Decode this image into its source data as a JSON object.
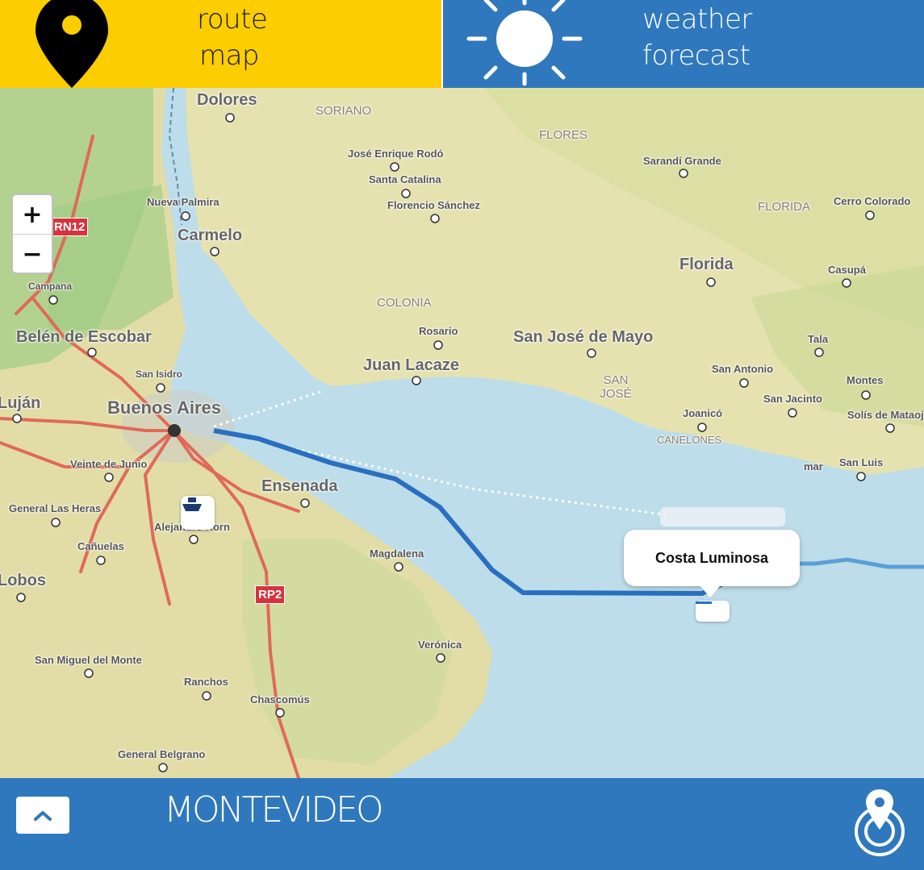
{
  "tabs": {
    "route": {
      "line1": "route",
      "line2": "map",
      "icon": "map-pin-icon",
      "color": "#fccd00"
    },
    "weather": {
      "line1": "weather",
      "line2": "forecast",
      "icon": "sun-icon",
      "color": "#2f78be"
    }
  },
  "map": {
    "zoom_in": "+",
    "zoom_out": "−",
    "labels": {
      "dolores": "Dolores",
      "soriano": "SORIANO",
      "flores": "FLORES",
      "jose_enrique_rodo": "José Enrique Rodó",
      "santa_catalina": "Santa Catalina",
      "florencio_sanchez": "Florencio Sánchez",
      "sarandi_grande": "Sarandí Grande",
      "florida_region": "FLORIDA",
      "cerro_colorado": "Cerro Colorado",
      "nueva_palmira": "Nueva Palmira",
      "carmelo": "Carmelo",
      "campana": "Campana",
      "florida": "Florida",
      "casupa": "Casupá",
      "colonia": "COLONIA",
      "belen_de_escobar": "Belén de Escobar",
      "rosario": "Rosario",
      "san_jose_de_mayo": "San José de Mayo",
      "tala": "Tala",
      "juan_lacaze": "Juan Lacaze",
      "san_isidro": "San Isidro",
      "san_antonio": "San Antonio",
      "montes": "Montes",
      "san_jose_region": "SAN JOSÉ",
      "lujan": "Luján",
      "buenos_aires": "Buenos Aires",
      "san_jacinto": "San Jacinto",
      "solis_de_mataojo": "Solís de Mataojo",
      "joanico": "Joanicó",
      "canelones": "CANELONES",
      "san_luis": "San Luis",
      "veinte_de_junio": "Veinte de Junio",
      "ensenada": "Ensenada",
      "general_las_heras": "General Las Heras",
      "alejandro_korn": "Alejandro Korn",
      "canuelas": "Cañuelas",
      "magdalena": "Magdalena",
      "lobos": "Lobos",
      "veronica": "Verónica",
      "san_miguel_del_monte": "San Miguel del Monte",
      "ranchos": "Ranchos",
      "chascomus": "Chascomús",
      "general_belgrano": "General Belgrano",
      "atlantida_fragment": "mar"
    },
    "road_badges": {
      "rn12": "RN12",
      "rp2": "RP2"
    },
    "popup": {
      "title": "Costa Luminosa"
    },
    "route_color": "#2a6fbf",
    "water_color": "#bcdde9"
  },
  "bottom_bar": {
    "port_name": "MONTEVIDEO",
    "expand_icon": "chevron-up-icon",
    "locate_icon": "location-target-icon",
    "color": "#2f78be"
  }
}
